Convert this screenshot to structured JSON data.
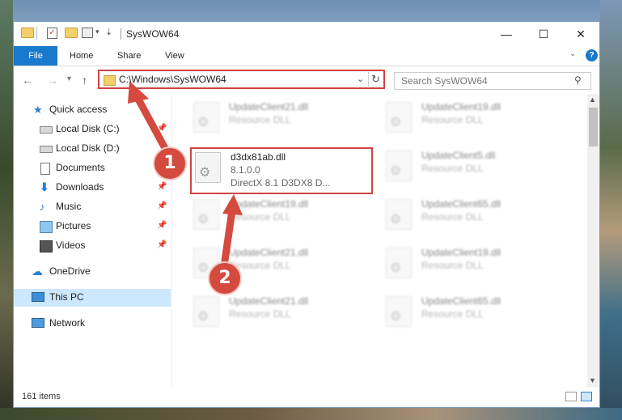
{
  "window": {
    "title": "SysWOW64",
    "controls": {
      "minimize": "—",
      "maximize": "☐",
      "close": "✕"
    }
  },
  "ribbon": {
    "file": "File",
    "tabs": [
      "Home",
      "Share",
      "View"
    ]
  },
  "address_bar": {
    "path": "C:\\Windows\\SysWOW64"
  },
  "search": {
    "placeholder": "Search SysWOW64"
  },
  "nav_pane": {
    "quick_access": "Quick access",
    "items": [
      {
        "label": "Local Disk (C:)",
        "icon": "disk-icon",
        "pinned": true
      },
      {
        "label": "Local Disk (D:)",
        "icon": "disk-icon",
        "pinned": false
      },
      {
        "label": "Documents",
        "icon": "documents-icon",
        "pinned": true
      },
      {
        "label": "Downloads",
        "icon": "download-icon",
        "pinned": true
      },
      {
        "label": "Music",
        "icon": "music-icon",
        "pinned": true
      },
      {
        "label": "Pictures",
        "icon": "pictures-icon",
        "pinned": true
      },
      {
        "label": "Videos",
        "icon": "videos-icon",
        "pinned": true
      }
    ],
    "onedrive": "OneDrive",
    "this_pc": "This PC",
    "network": "Network"
  },
  "files": {
    "highlighted": {
      "name": "d3dx81ab.dll",
      "version": "8.1.0.0",
      "description": "DirectX 8.1 D3DX8 D..."
    },
    "blurred": [
      {
        "name": "UpdateClient21.dll",
        "type": "Resource DLL"
      },
      {
        "name": "UpdateClient19.dll",
        "type": "Resource DLL"
      },
      {
        "name": "UpdateClient5.dll",
        "type": "Resource DLL"
      },
      {
        "name": "UpdateClient19.dll",
        "type": "Resource DLL"
      },
      {
        "name": "UpdateClient65.dll",
        "type": "Resource DLL"
      },
      {
        "name": "UpdateClient21.dll",
        "type": "Resource DLL"
      },
      {
        "name": "UpdateClient19.dll",
        "type": "Resource DLL"
      },
      {
        "name": "UpdateClient21.dll",
        "type": "Resource DLL"
      },
      {
        "name": "UpdateClient65.dll",
        "type": "Resource DLL"
      }
    ]
  },
  "status": {
    "item_count": "161 items"
  },
  "annotations": {
    "step1": "1",
    "step2": "2",
    "color": "#d44a3f"
  }
}
